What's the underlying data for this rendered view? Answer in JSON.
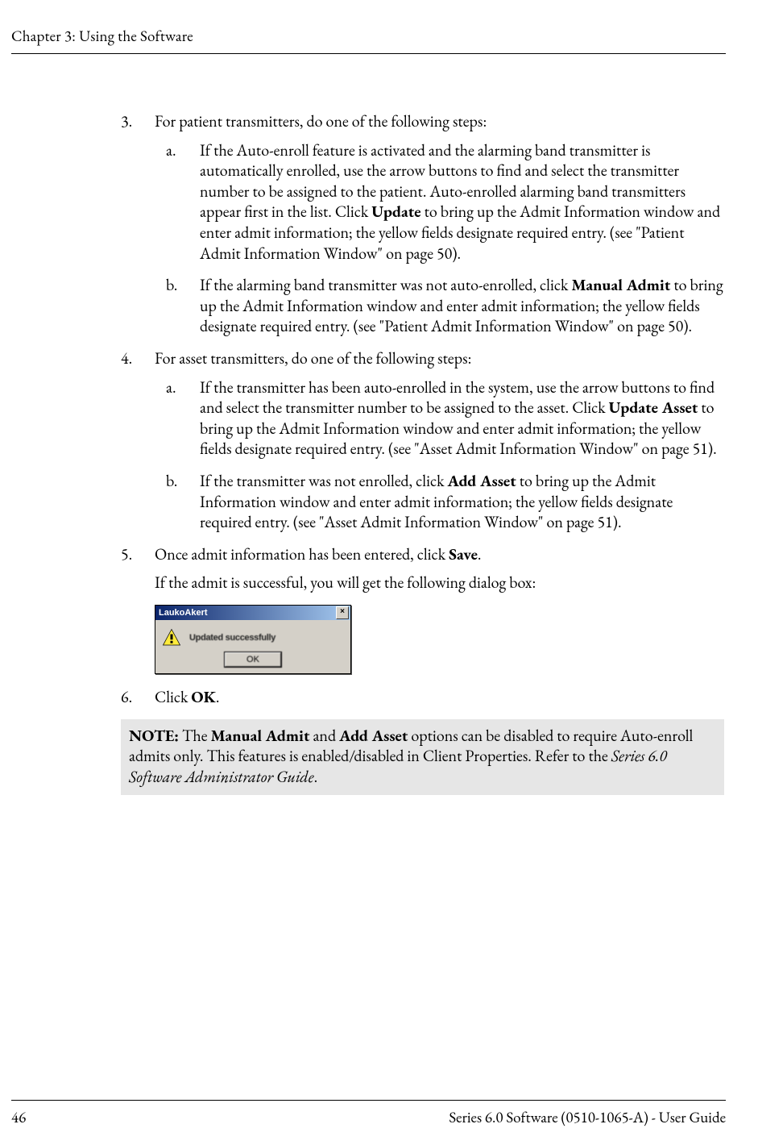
{
  "header": {
    "running": "Chapter 3: Using the Software"
  },
  "list": {
    "item3": {
      "lead": "For patient transmitters, do one of the following steps:",
      "a": {
        "pre": "If the Auto-enroll feature is activated and the alarming band transmitter is automatically enrolled, use the arrow buttons to find and select the transmitter number to be assigned to the patient. Auto-enrolled alarming band transmitters appear first in the list. Click ",
        "bold": "Update",
        "post": " to bring up the Admit Information window and enter admit information; the yellow fields designate required entry. (see \"Patient Admit Information Window\" on page 50)."
      },
      "b": {
        "pre": "If the alarming band transmitter was not auto-enrolled, click ",
        "bold": "Manual Admit",
        "post": " to bring up the Admit Information window and enter admit information; the yellow fields designate required entry. (see \"Patient Admit Information Window\" on page 50)."
      }
    },
    "item4": {
      "lead": "For asset transmitters, do one of the following steps:",
      "a": {
        "pre": "If the transmitter has been auto-enrolled in the system, use the arrow buttons to find and select the transmitter number to be assigned to the asset. Click ",
        "bold": "Update Asset",
        "post": " to bring up the Admit Information window and enter admit information; the yellow fields designate required entry. (see \"Asset Admit Information Window\" on page 51)."
      },
      "b": {
        "pre": "If the transmitter was not enrolled, click ",
        "bold": "Add Asset",
        "post": " to bring up the Admit Information window and enter admit information; the yellow fields designate required entry. (see \"Asset Admit Information Window\" on page 51)."
      }
    },
    "item5": {
      "pre": "Once admit information has been entered, click ",
      "bold": "Save",
      "post": ".",
      "followup": "If the admit is successful, you will get the following dialog box:"
    },
    "item6": {
      "pre": "Click ",
      "bold": "OK",
      "post": "."
    }
  },
  "dialog": {
    "title": "LaukoAkert",
    "message": "Updated successfully",
    "ok": "OK"
  },
  "note": {
    "label": "NOTE:",
    "seg1": " The ",
    "b1": "Manual Admit",
    "seg2": " and ",
    "b2": "Add Asset",
    "seg3": " options can be disabled to require Auto-enroll admits only. This features is enabled/disabled in Client Properties. Refer to the ",
    "it": "Series 6.0 Software Administrator Guide",
    "seg4": "."
  },
  "footer": {
    "page": "46",
    "right": "Series 6.0 Software (0510-1065-A) - User Guide"
  }
}
